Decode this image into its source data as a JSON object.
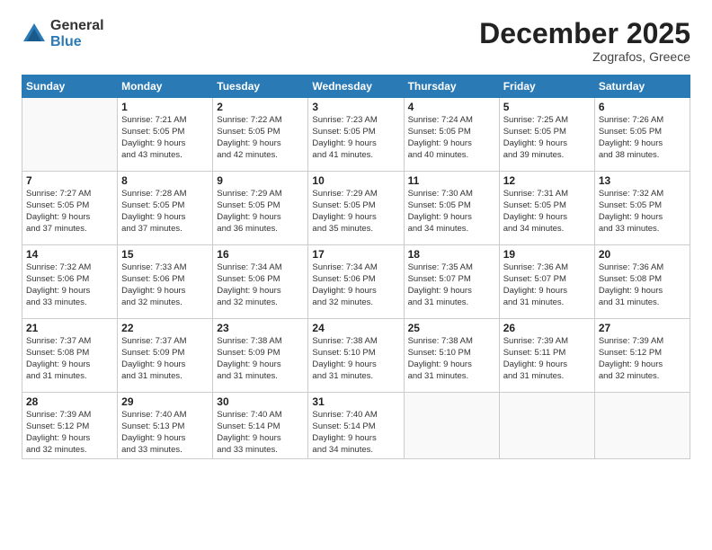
{
  "header": {
    "logo_general": "General",
    "logo_blue": "Blue",
    "month_title": "December 2025",
    "location": "Zografos, Greece"
  },
  "days_of_week": [
    "Sunday",
    "Monday",
    "Tuesday",
    "Wednesday",
    "Thursday",
    "Friday",
    "Saturday"
  ],
  "weeks": [
    [
      {
        "day": "",
        "info": ""
      },
      {
        "day": "1",
        "info": "Sunrise: 7:21 AM\nSunset: 5:05 PM\nDaylight: 9 hours\nand 43 minutes."
      },
      {
        "day": "2",
        "info": "Sunrise: 7:22 AM\nSunset: 5:05 PM\nDaylight: 9 hours\nand 42 minutes."
      },
      {
        "day": "3",
        "info": "Sunrise: 7:23 AM\nSunset: 5:05 PM\nDaylight: 9 hours\nand 41 minutes."
      },
      {
        "day": "4",
        "info": "Sunrise: 7:24 AM\nSunset: 5:05 PM\nDaylight: 9 hours\nand 40 minutes."
      },
      {
        "day": "5",
        "info": "Sunrise: 7:25 AM\nSunset: 5:05 PM\nDaylight: 9 hours\nand 39 minutes."
      },
      {
        "day": "6",
        "info": "Sunrise: 7:26 AM\nSunset: 5:05 PM\nDaylight: 9 hours\nand 38 minutes."
      }
    ],
    [
      {
        "day": "7",
        "info": "Sunrise: 7:27 AM\nSunset: 5:05 PM\nDaylight: 9 hours\nand 37 minutes."
      },
      {
        "day": "8",
        "info": "Sunrise: 7:28 AM\nSunset: 5:05 PM\nDaylight: 9 hours\nand 37 minutes."
      },
      {
        "day": "9",
        "info": "Sunrise: 7:29 AM\nSunset: 5:05 PM\nDaylight: 9 hours\nand 36 minutes."
      },
      {
        "day": "10",
        "info": "Sunrise: 7:29 AM\nSunset: 5:05 PM\nDaylight: 9 hours\nand 35 minutes."
      },
      {
        "day": "11",
        "info": "Sunrise: 7:30 AM\nSunset: 5:05 PM\nDaylight: 9 hours\nand 34 minutes."
      },
      {
        "day": "12",
        "info": "Sunrise: 7:31 AM\nSunset: 5:05 PM\nDaylight: 9 hours\nand 34 minutes."
      },
      {
        "day": "13",
        "info": "Sunrise: 7:32 AM\nSunset: 5:05 PM\nDaylight: 9 hours\nand 33 minutes."
      }
    ],
    [
      {
        "day": "14",
        "info": "Sunrise: 7:32 AM\nSunset: 5:06 PM\nDaylight: 9 hours\nand 33 minutes."
      },
      {
        "day": "15",
        "info": "Sunrise: 7:33 AM\nSunset: 5:06 PM\nDaylight: 9 hours\nand 32 minutes."
      },
      {
        "day": "16",
        "info": "Sunrise: 7:34 AM\nSunset: 5:06 PM\nDaylight: 9 hours\nand 32 minutes."
      },
      {
        "day": "17",
        "info": "Sunrise: 7:34 AM\nSunset: 5:06 PM\nDaylight: 9 hours\nand 32 minutes."
      },
      {
        "day": "18",
        "info": "Sunrise: 7:35 AM\nSunset: 5:07 PM\nDaylight: 9 hours\nand 31 minutes."
      },
      {
        "day": "19",
        "info": "Sunrise: 7:36 AM\nSunset: 5:07 PM\nDaylight: 9 hours\nand 31 minutes."
      },
      {
        "day": "20",
        "info": "Sunrise: 7:36 AM\nSunset: 5:08 PM\nDaylight: 9 hours\nand 31 minutes."
      }
    ],
    [
      {
        "day": "21",
        "info": "Sunrise: 7:37 AM\nSunset: 5:08 PM\nDaylight: 9 hours\nand 31 minutes."
      },
      {
        "day": "22",
        "info": "Sunrise: 7:37 AM\nSunset: 5:09 PM\nDaylight: 9 hours\nand 31 minutes."
      },
      {
        "day": "23",
        "info": "Sunrise: 7:38 AM\nSunset: 5:09 PM\nDaylight: 9 hours\nand 31 minutes."
      },
      {
        "day": "24",
        "info": "Sunrise: 7:38 AM\nSunset: 5:10 PM\nDaylight: 9 hours\nand 31 minutes."
      },
      {
        "day": "25",
        "info": "Sunrise: 7:38 AM\nSunset: 5:10 PM\nDaylight: 9 hours\nand 31 minutes."
      },
      {
        "day": "26",
        "info": "Sunrise: 7:39 AM\nSunset: 5:11 PM\nDaylight: 9 hours\nand 31 minutes."
      },
      {
        "day": "27",
        "info": "Sunrise: 7:39 AM\nSunset: 5:12 PM\nDaylight: 9 hours\nand 32 minutes."
      }
    ],
    [
      {
        "day": "28",
        "info": "Sunrise: 7:39 AM\nSunset: 5:12 PM\nDaylight: 9 hours\nand 32 minutes."
      },
      {
        "day": "29",
        "info": "Sunrise: 7:40 AM\nSunset: 5:13 PM\nDaylight: 9 hours\nand 33 minutes."
      },
      {
        "day": "30",
        "info": "Sunrise: 7:40 AM\nSunset: 5:14 PM\nDaylight: 9 hours\nand 33 minutes."
      },
      {
        "day": "31",
        "info": "Sunrise: 7:40 AM\nSunset: 5:14 PM\nDaylight: 9 hours\nand 34 minutes."
      },
      {
        "day": "",
        "info": ""
      },
      {
        "day": "",
        "info": ""
      },
      {
        "day": "",
        "info": ""
      }
    ]
  ]
}
